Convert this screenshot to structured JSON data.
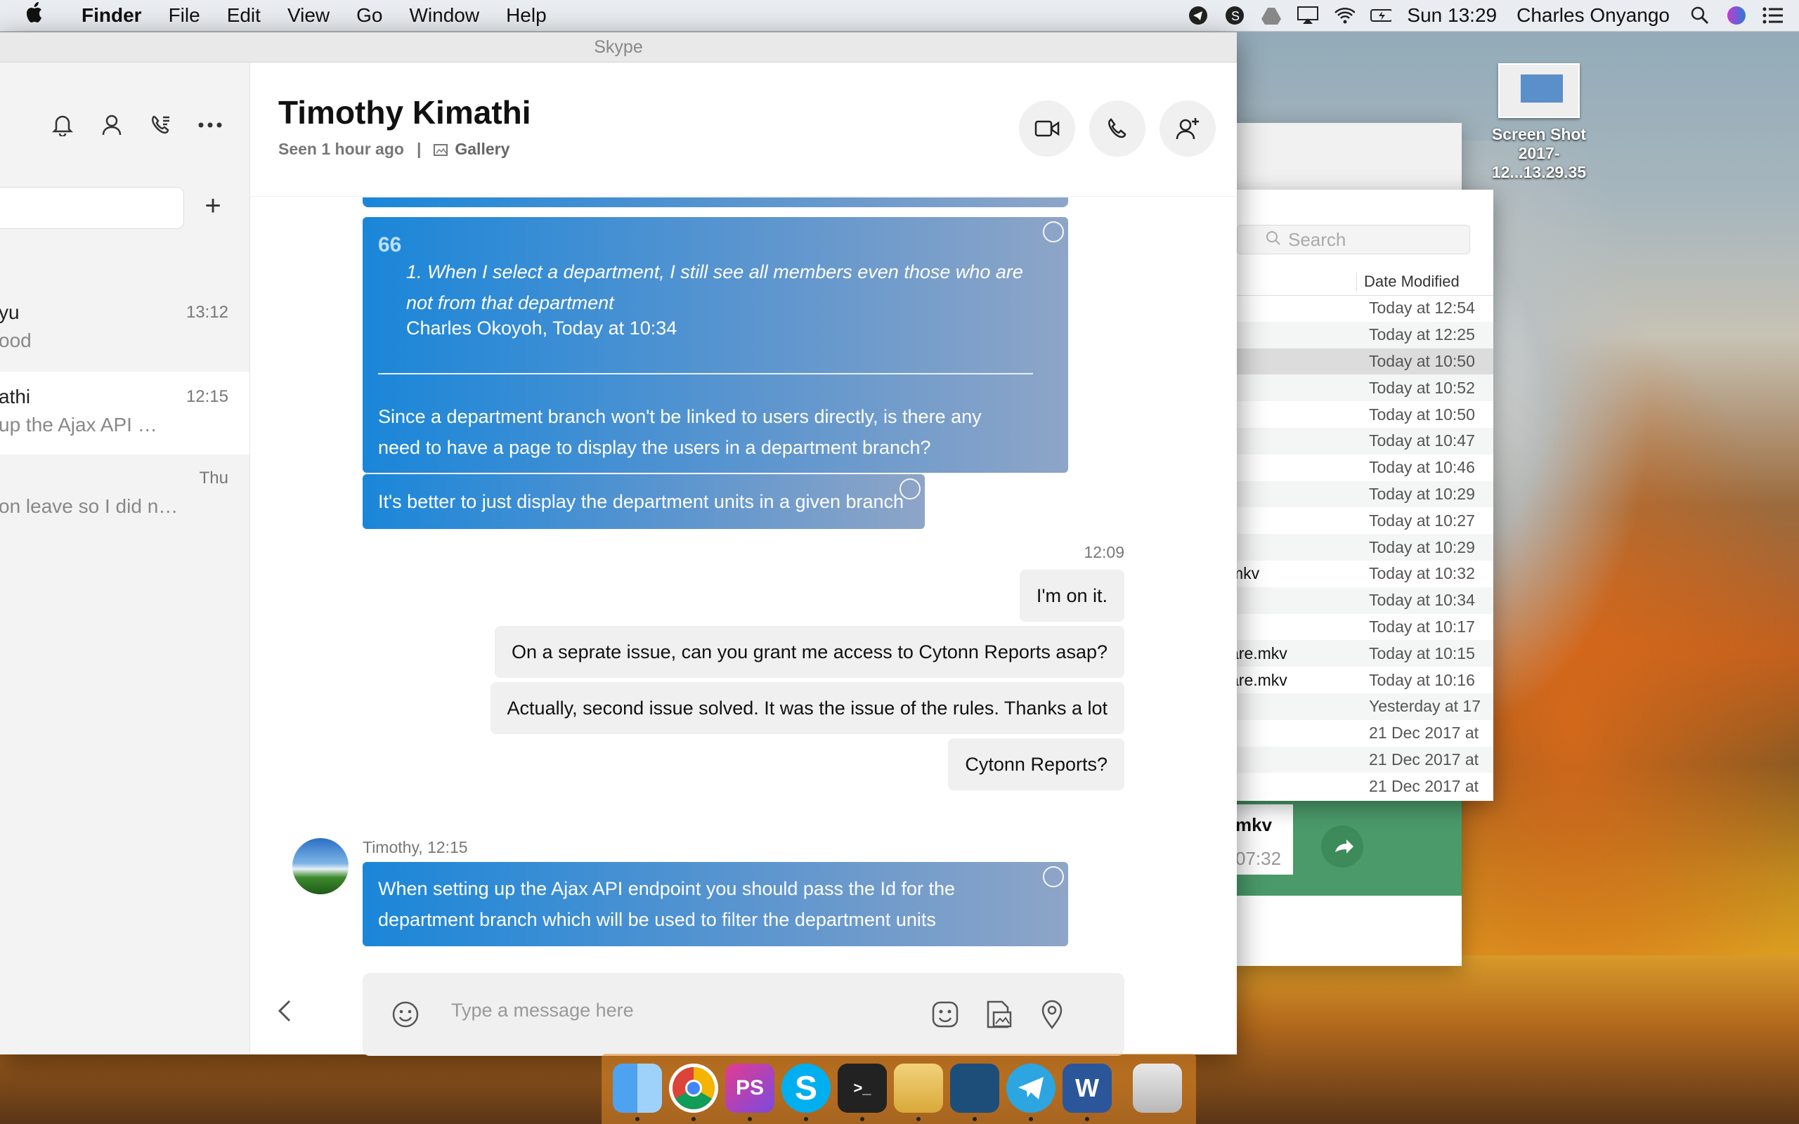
{
  "menubar": {
    "items": [
      "Finder",
      "File",
      "Edit",
      "View",
      "Go",
      "Window",
      "Help"
    ],
    "clock": "Sun 13:29",
    "user": "Charles Onyango"
  },
  "desktop": {
    "icon_label_1": "Screen Shot",
    "icon_label_2": "2017-12...13.29.35"
  },
  "finder": {
    "search_placeholder": "Search",
    "column_header": "Date Modified",
    "rows": [
      {
        "name": "",
        "date": "Today at 12:54"
      },
      {
        "name": "",
        "date": "Today at 12:25"
      },
      {
        "name": "",
        "date": "Today at 10:50"
      },
      {
        "name": "",
        "date": "Today at 10:52"
      },
      {
        "name": "",
        "date": "Today at 10:50"
      },
      {
        "name": "",
        "date": "Today at 10:47"
      },
      {
        "name": "",
        "date": "Today at 10:46"
      },
      {
        "name": "",
        "date": "Today at 10:29"
      },
      {
        "name": "",
        "date": "Today at 10:27"
      },
      {
        "name": "",
        "date": "Today at 10:29"
      },
      {
        "name": "mkv",
        "date": "Today at 10:32"
      },
      {
        "name": "",
        "date": "Today at 10:34"
      },
      {
        "name": "",
        "date": "Today at 10:17"
      },
      {
        "name": "are.mkv",
        "date": "Today at 10:15"
      },
      {
        "name": "are.mkv",
        "date": "Today at 10:16"
      },
      {
        "name": "",
        "date": "Yesterday at 17"
      },
      {
        "name": "",
        "date": "21 Dec 2017 at"
      },
      {
        "name": "",
        "date": "21 Dec 2017 at"
      },
      {
        "name": "",
        "date": "21 Dec 2017 at"
      }
    ],
    "card_title": "mkv",
    "card_time": "07:32"
  },
  "skype": {
    "window_title": "Skype",
    "conversations": [
      {
        "name": "yu",
        "preview": "ood",
        "time": "13:12"
      },
      {
        "name": "athi",
        "preview": "up the Ajax API …",
        "time": "12:15"
      },
      {
        "name": "",
        "preview": "on leave so I did n…",
        "time": "Thu"
      }
    ],
    "contact_name": "Timothy Kimathi",
    "seen": "Seen 1 hour ago",
    "separator": "|",
    "gallery": "Gallery",
    "quote": {
      "mark": "66",
      "text": "1. When I select a department, I still see all members even those who are not from that department",
      "by": "Charles Okoyoh, Today at 10:34",
      "reply": "Since a department branch won't be linked to users directly,  is there any need to have a page to display the users in a department branch?"
    },
    "msg_units": "It's better to just display the department units in a given branch",
    "out_time": "12:09",
    "out_messages": [
      "I'm on it.",
      "On a seprate issue, can you grant me access to Cytonn Reports asap?",
      "Actually, second issue solved. It was the issue of the rules. Thanks a lot",
      "Cytonn Reports?"
    ],
    "sender_line": "Timothy, 12:15",
    "last_msg": "When setting up the Ajax API endpoint you should pass the Id for the department branch which will be used to filter the department units",
    "composer_placeholder": "Type a message here"
  },
  "colors": {
    "bubble_in_start": "#1a86d9",
    "bubble_in_end": "#8ea5c7",
    "bubble_out": "#f0f0f0"
  },
  "dock_apps": [
    "finder-icon",
    "chrome-icon",
    "phpstorm-icon",
    "skype-icon",
    "terminal-icon",
    "sequel-pro-icon",
    "mysql-workbench-icon",
    "telegram-icon",
    "word-icon",
    "trash-icon"
  ]
}
